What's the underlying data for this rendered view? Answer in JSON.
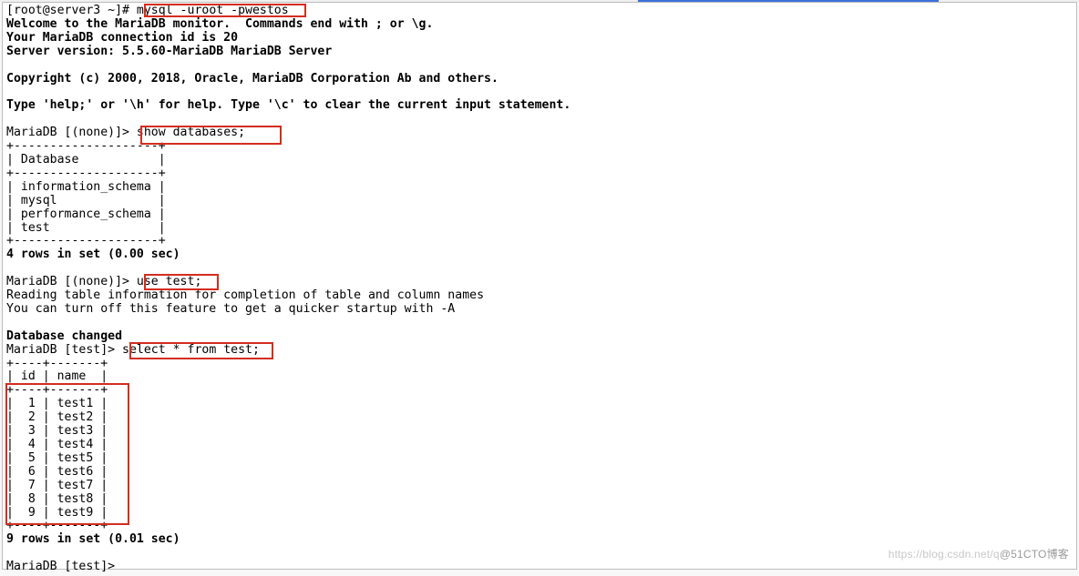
{
  "shell": {
    "prompt": "[root@server3 ~]# ",
    "command": "mysql -uroot -pwestos"
  },
  "welcome": {
    "line1": "Welcome to the MariaDB monitor.  Commands end with ; or \\g.",
    "line2": "Your MariaDB connection id is 20",
    "line3": "Server version: 5.5.60-MariaDB MariaDB Server",
    "copyright": "Copyright (c) 2000, 2018, Oracle, MariaDB Corporation Ab and others.",
    "help": "Type 'help;' or '\\h' for help. Type '\\c' to clear the current input statement."
  },
  "prompts": {
    "none": "MariaDB [(none)]> ",
    "test": "MariaDB [test]> "
  },
  "cmd_show_db": "show databases;",
  "db_table": {
    "border": "+--------------------+",
    "header": "| Database           |",
    "rows": [
      "| information_schema |",
      "| mysql              |",
      "| performance_schema |",
      "| test               |"
    ],
    "footer": "4 rows in set (0.00 sec)"
  },
  "cmd_use_test": "use test;",
  "use_test_out": {
    "l1": "Reading table information for completion of table and column names",
    "l2": "You can turn off this feature to get a quicker startup with -A",
    "changed": "Database changed"
  },
  "cmd_select": "select * from test;",
  "result_table": {
    "border": "+----+-------+",
    "header": "| id | name  |",
    "rows": [
      "|  1 | test1 |",
      "|  2 | test2 |",
      "|  3 | test3 |",
      "|  4 | test4 |",
      "|  5 | test5 |",
      "|  6 | test6 |",
      "|  7 | test7 |",
      "|  8 | test8 |",
      "|  9 | test9 |"
    ],
    "footer": "9 rows in set (0.01 sec)"
  },
  "final_prompt_extra": "",
  "watermark": {
    "left": "https://blog.csdn.net/q",
    "right": "@51CTO博客"
  },
  "chart_data": {
    "type": "table",
    "title": "select * from test;",
    "columns": [
      "id",
      "name"
    ],
    "rows": [
      [
        1,
        "test1"
      ],
      [
        2,
        "test2"
      ],
      [
        3,
        "test3"
      ],
      [
        4,
        "test4"
      ],
      [
        5,
        "test5"
      ],
      [
        6,
        "test6"
      ],
      [
        7,
        "test7"
      ],
      [
        8,
        "test8"
      ],
      [
        9,
        "test9"
      ]
    ]
  }
}
